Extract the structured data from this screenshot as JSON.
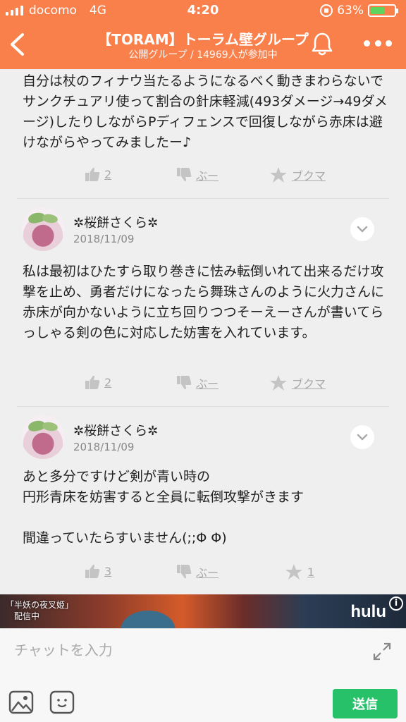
{
  "status_bar": {
    "carrier": "docomo",
    "network": "4G",
    "time": "4:20",
    "battery": "63%",
    "battery_level": 0.63
  },
  "header": {
    "title": "【TORAM】トーラム壁グループ",
    "subtitle": "公開グループ / 14969人が参加中"
  },
  "posts": [
    {
      "text": "自分は杖のフィナウ当たるようになるべく動きまわらないでサンクチュアリ使って割合の針床軽減(493ダメージ→49ダメージ)したりしながらPディフェンスで回復しながら赤床は避けながらやってみましたー♪",
      "likes": "2",
      "dislike_label": "ぶー",
      "bookmark_label": "ブクマ"
    },
    {
      "username": "✲桜餅さくら✲",
      "date": "2018/11/09",
      "text": "私は最初はひたすら取り巻きに怯み転倒いれて出来るだけ攻撃を止め、勇者だけになったら舞珠さんのように火力さんに赤床が向かないように立ち回りつつそーえーさんが書いてらっしゃる剣の色に対応した妨害を入れています。",
      "likes": "2",
      "dislike_label": "ぶー",
      "bookmark_label": "ブクマ"
    },
    {
      "username": "✲桜餅さくら✲",
      "date": "2018/11/09",
      "text_lines": [
        "あと多分ですけど剣が青い時の",
        "円形青床を妨害すると全員に転倒攻撃がきます",
        "",
        "間違っていたらすいません(;;Φ Φ)"
      ],
      "likes": "3",
      "dislike_label": "ぶー",
      "bookmark_label": "1"
    }
  ],
  "ad": {
    "caption_line1": "「半妖の夜叉姫」",
    "caption_line2": "配信中",
    "brand": "hulu",
    "info": "i"
  },
  "chat": {
    "placeholder": "チャットを入力",
    "send_label": "送信"
  },
  "colors": {
    "accent": "#f97f4b",
    "send": "#27c16a",
    "action_gray": "#a9a9a9"
  }
}
